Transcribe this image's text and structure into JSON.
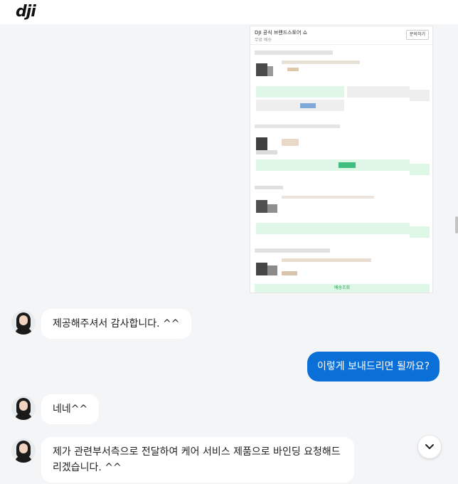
{
  "header": {
    "logo_text": "dji"
  },
  "shared_image": {
    "title": "DJI 공식 브랜드스토어 쇼",
    "subtitle": "무료 배송",
    "inquiry_button": "문의하기",
    "footer_button": "배송조회"
  },
  "messages": [
    {
      "sender": "agent",
      "text": "제공해주셔서 감사합니다. ^^"
    },
    {
      "sender": "user",
      "text": "이렇게 보내드리면 될까요?"
    },
    {
      "sender": "agent",
      "text": "네네^^"
    },
    {
      "sender": "agent",
      "text": "제가 관련부서측으로 전달하여 케어 서비스 제품으로 바인딩 요청해드리겠습니다. ^^"
    }
  ],
  "colors": {
    "user_bubble": "#0a6fd6",
    "agent_bubble": "#ffffff",
    "background": "#f4f5f7"
  },
  "icons": {
    "scroll_down": "chevron-down-icon"
  }
}
